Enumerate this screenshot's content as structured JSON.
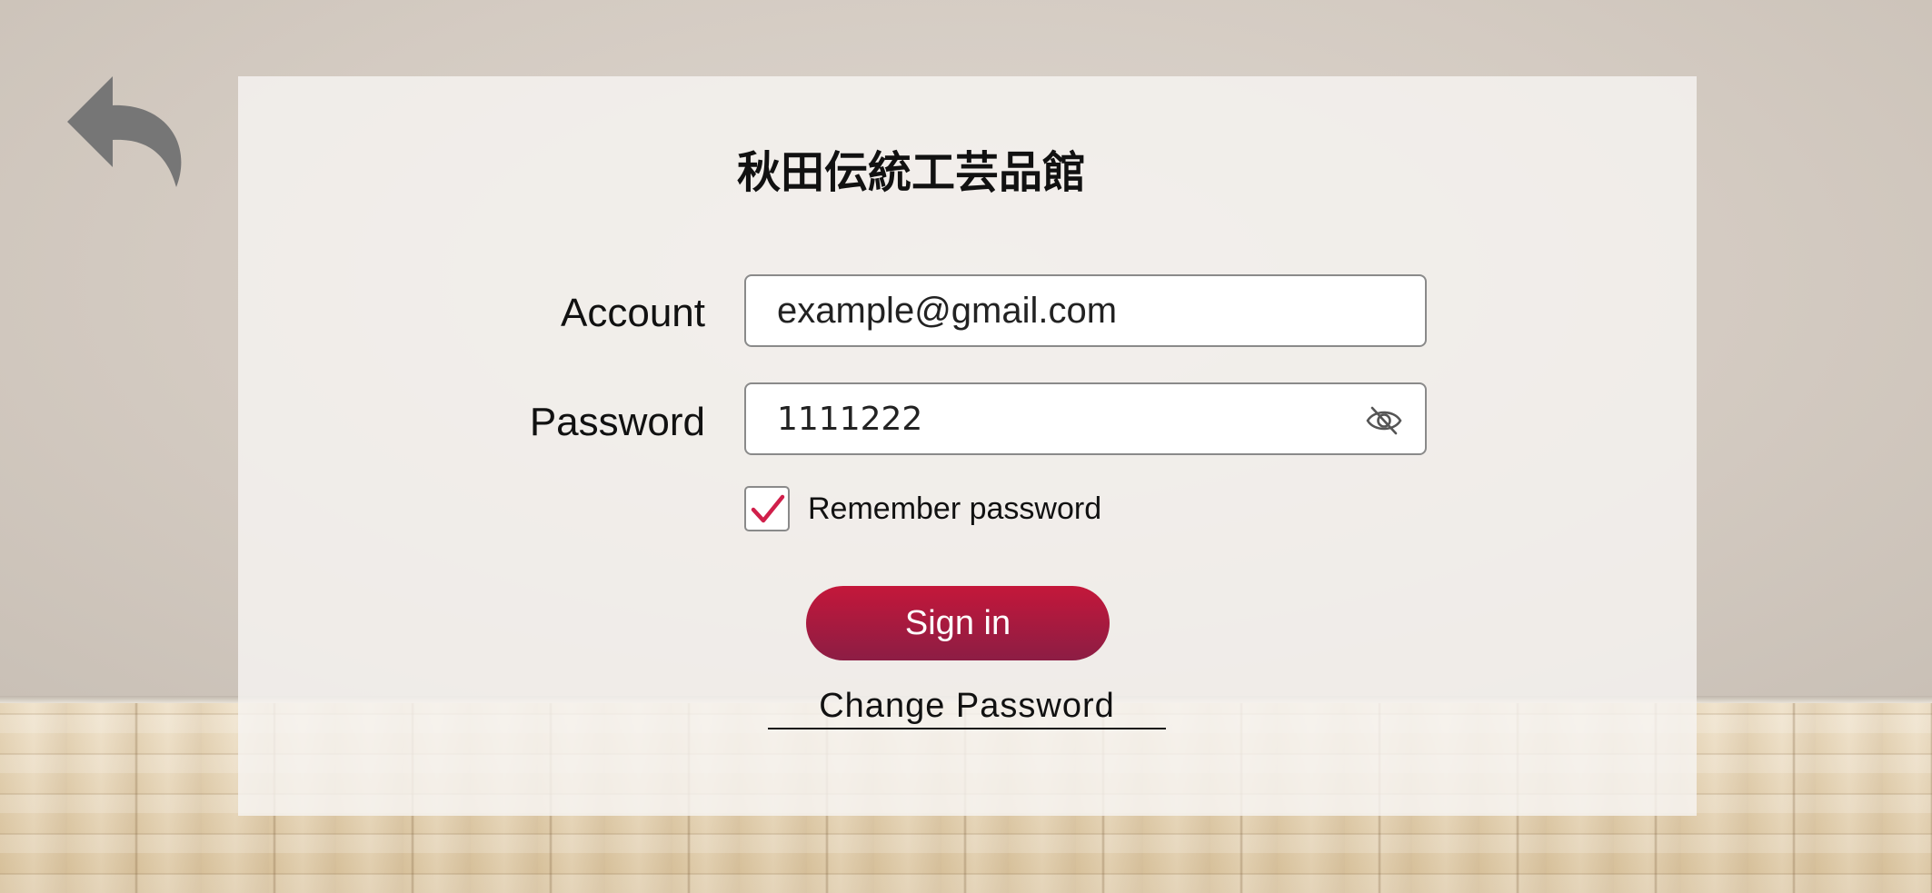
{
  "app": {
    "title": "秋田伝統工芸品館"
  },
  "nav": {
    "back_icon": "back-arrow-icon"
  },
  "form": {
    "account": {
      "label": "Account",
      "value": "example@gmail.com"
    },
    "password": {
      "label": "Password",
      "value": "1111222",
      "visibility_icon": "eye-slash-icon"
    },
    "remember": {
      "label": "Remember password",
      "checked": true,
      "check_color": "#d01f4a"
    },
    "signin_label": "Sign in",
    "change_password_label": "Change Password"
  },
  "colors": {
    "accent": "#c4173a",
    "accent_dark": "#8c1d44"
  }
}
